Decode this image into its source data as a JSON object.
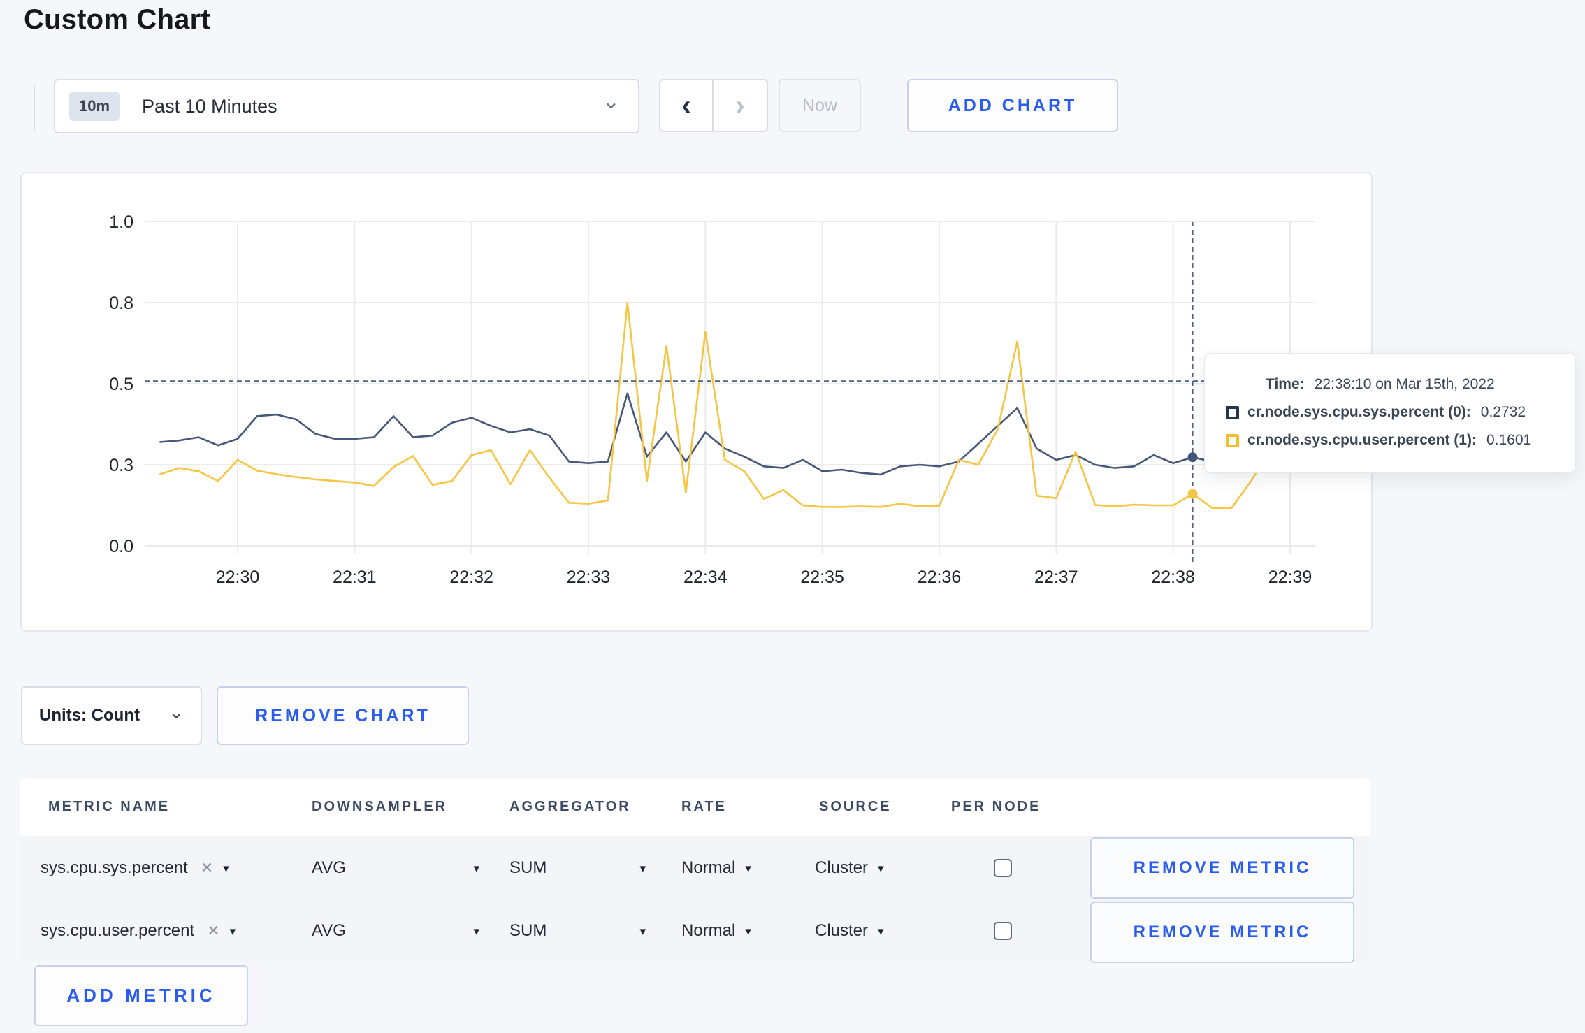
{
  "page": {
    "title": "Custom Chart"
  },
  "icons": {
    "chevron_down": "⌄",
    "caret_down": "▾",
    "close": "✕",
    "prev": "‹",
    "next": "›"
  },
  "toolbar": {
    "time_window_badge": "10m",
    "time_window_label": "Past 10 Minutes",
    "now_label": "Now",
    "add_chart_label": "ADD CHART"
  },
  "chart_controls": {
    "units_label": "Units: Count",
    "remove_chart_label": "REMOVE CHART"
  },
  "tooltip": {
    "time_label": "Time:",
    "time_value": "22:38:10 on Mar 15th, 2022",
    "sys_label": "cr.node.sys.cpu.sys.percent (0):",
    "sys_value": "0.2732",
    "user_label": "cr.node.sys.cpu.user.percent (1):",
    "user_value": "0.1601"
  },
  "chart_data": {
    "type": "line",
    "title": "",
    "xlabel": "",
    "ylabel": "",
    "ylim": [
      0,
      1
    ],
    "grid": true,
    "legend_position": "tooltip",
    "y_ticks": [
      {
        "value": 0.0,
        "label": "0.0"
      },
      {
        "value": 0.25,
        "label": "0.3"
      },
      {
        "value": 0.5,
        "label": "0.5"
      },
      {
        "value": 0.75,
        "label": "0.8"
      },
      {
        "value": 1.0,
        "label": "1.0"
      }
    ],
    "x_ticks": [
      "22:30",
      "22:31",
      "22:32",
      "22:33",
      "22:34",
      "22:35",
      "22:36",
      "22:37",
      "22:38",
      "22:39"
    ],
    "x": [
      "22:29:20",
      "22:29:30",
      "22:29:40",
      "22:29:50",
      "22:30:00",
      "22:30:10",
      "22:30:20",
      "22:30:30",
      "22:30:40",
      "22:30:50",
      "22:31:00",
      "22:31:10",
      "22:31:20",
      "22:31:30",
      "22:31:40",
      "22:31:50",
      "22:32:00",
      "22:32:10",
      "22:32:20",
      "22:32:30",
      "22:32:40",
      "22:32:50",
      "22:33:00",
      "22:33:10",
      "22:33:20",
      "22:33:30",
      "22:33:40",
      "22:33:50",
      "22:34:00",
      "22:34:10",
      "22:34:20",
      "22:34:30",
      "22:34:40",
      "22:34:50",
      "22:35:00",
      "22:35:10",
      "22:35:20",
      "22:35:30",
      "22:35:40",
      "22:35:50",
      "22:36:00",
      "22:36:10",
      "22:36:20",
      "22:36:30",
      "22:36:40",
      "22:36:50",
      "22:37:00",
      "22:37:10",
      "22:37:20",
      "22:37:30",
      "22:37:40",
      "22:37:50",
      "22:38:00",
      "22:38:10",
      "22:38:20",
      "22:38:30",
      "22:38:40",
      "22:38:50",
      "22:39:00",
      "22:39:10"
    ],
    "series": [
      {
        "name": "cr.node.sys.cpu.sys.percent",
        "color": "#46587a",
        "values": [
          0.32,
          0.325,
          0.335,
          0.31,
          0.33,
          0.4,
          0.405,
          0.39,
          0.345,
          0.33,
          0.33,
          0.335,
          0.4,
          0.335,
          0.34,
          0.38,
          0.395,
          0.37,
          0.35,
          0.36,
          0.34,
          0.26,
          0.255,
          0.26,
          0.47,
          0.275,
          0.35,
          0.26,
          0.35,
          0.3,
          0.275,
          0.245,
          0.24,
          0.265,
          0.23,
          0.235,
          0.225,
          0.22,
          0.245,
          0.25,
          0.245,
          0.26,
          0.315,
          0.37,
          0.425,
          0.3,
          0.265,
          0.28,
          0.25,
          0.24,
          0.245,
          0.28,
          0.255,
          0.2732,
          0.26,
          0.27,
          0.275,
          0.27,
          0.275,
          0.27
        ]
      },
      {
        "name": "cr.node.sys.cpu.user.percent",
        "color": "#f5c543",
        "values": [
          0.22,
          0.24,
          0.23,
          0.2,
          0.265,
          0.232,
          0.221,
          0.212,
          0.205,
          0.2,
          0.195,
          0.185,
          0.243,
          0.277,
          0.188,
          0.2,
          0.28,
          0.295,
          0.19,
          0.295,
          0.21,
          0.133,
          0.13,
          0.14,
          0.75,
          0.2,
          0.616,
          0.165,
          0.66,
          0.265,
          0.23,
          0.145,
          0.172,
          0.125,
          0.12,
          0.12,
          0.122,
          0.12,
          0.13,
          0.122,
          0.123,
          0.265,
          0.25,
          0.36,
          0.63,
          0.155,
          0.147,
          0.29,
          0.126,
          0.122,
          0.127,
          0.125,
          0.125,
          0.1601,
          0.117,
          0.117,
          0.2,
          0.3,
          0.25,
          0.26
        ]
      }
    ],
    "crosshair": {
      "time": "22:38:10",
      "hover_value": 0.508
    },
    "colors": {
      "grid": "#ebebeb",
      "crosshair": "#4a6383",
      "axis_text": "#20242c"
    }
  },
  "metrics_table": {
    "headers": {
      "metric_name": "METRIC NAME",
      "downsampler": "DOWNSAMPLER",
      "aggregator": "AGGREGATOR",
      "rate": "RATE",
      "source": "SOURCE",
      "per_node": "PER NODE"
    },
    "rows": [
      {
        "metric_name": "sys.cpu.sys.percent",
        "downsampler": "AVG",
        "aggregator": "SUM",
        "rate": "Normal",
        "source": "Cluster",
        "per_node_checked": false,
        "remove_label": "REMOVE METRIC"
      },
      {
        "metric_name": "sys.cpu.user.percent",
        "downsampler": "AVG",
        "aggregator": "SUM",
        "rate": "Normal",
        "source": "Cluster",
        "per_node_checked": false,
        "remove_label": "REMOVE METRIC"
      }
    ],
    "add_metric_label": "ADD METRIC"
  }
}
